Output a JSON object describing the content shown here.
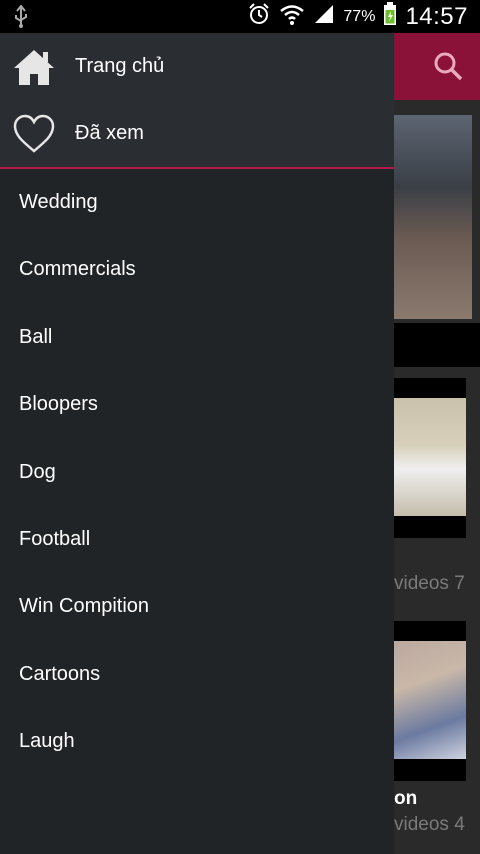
{
  "status_bar": {
    "battery_percent": "77%",
    "time": "14:57"
  },
  "drawer": {
    "home_label": "Trang chủ",
    "viewed_label": "Đã xem",
    "categories": [
      "Wedding",
      "Commercials",
      "Ball",
      "Bloopers",
      "Dog",
      "Football",
      "Win Compition",
      "Cartoons",
      "Laugh"
    ]
  },
  "background": {
    "count_1": "7 videos",
    "title_3": "on",
    "count_3": "4 videos"
  },
  "colors": {
    "accent": "#b4194e",
    "appbar": "#8a1239",
    "drawer_bg": "#202427"
  },
  "icons": [
    "usb-icon",
    "alarm-icon",
    "wifi-icon",
    "signal-icon",
    "battery-icon",
    "home-icon",
    "heart-icon",
    "search-icon"
  ]
}
